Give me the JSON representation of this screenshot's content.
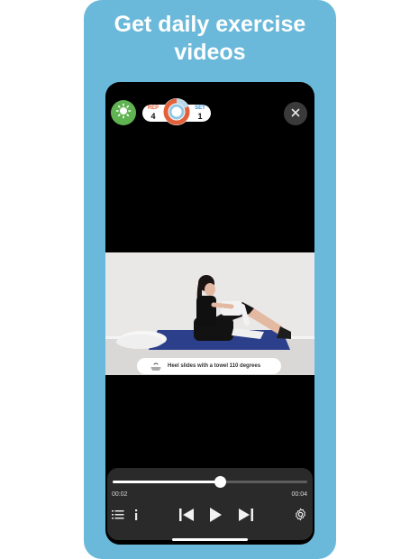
{
  "headline": {
    "line1": "Get daily exercise",
    "line2": "videos"
  },
  "counter": {
    "rep_label": "REP",
    "rep_value": "4",
    "set_label": "SET",
    "set_value": "1"
  },
  "video": {
    "caption": "Heel slides with a towel 110 degrees"
  },
  "player": {
    "elapsed": "00:02",
    "duration": "00:04",
    "progress": 0.55
  },
  "colors": {
    "card": "#6bb9da",
    "sun_button": "#5fb351",
    "rep_color": "#e2613b",
    "set_color": "#3a8fd0",
    "ring_accent": "#e2613b"
  },
  "icons": {
    "sun": "sun-icon",
    "close": "close-icon",
    "caption": "exercise-icon",
    "list": "list-icon",
    "info": "info-icon",
    "prev": "skip-previous-icon",
    "play": "play-icon",
    "next": "skip-next-icon",
    "settings": "gear-icon"
  }
}
